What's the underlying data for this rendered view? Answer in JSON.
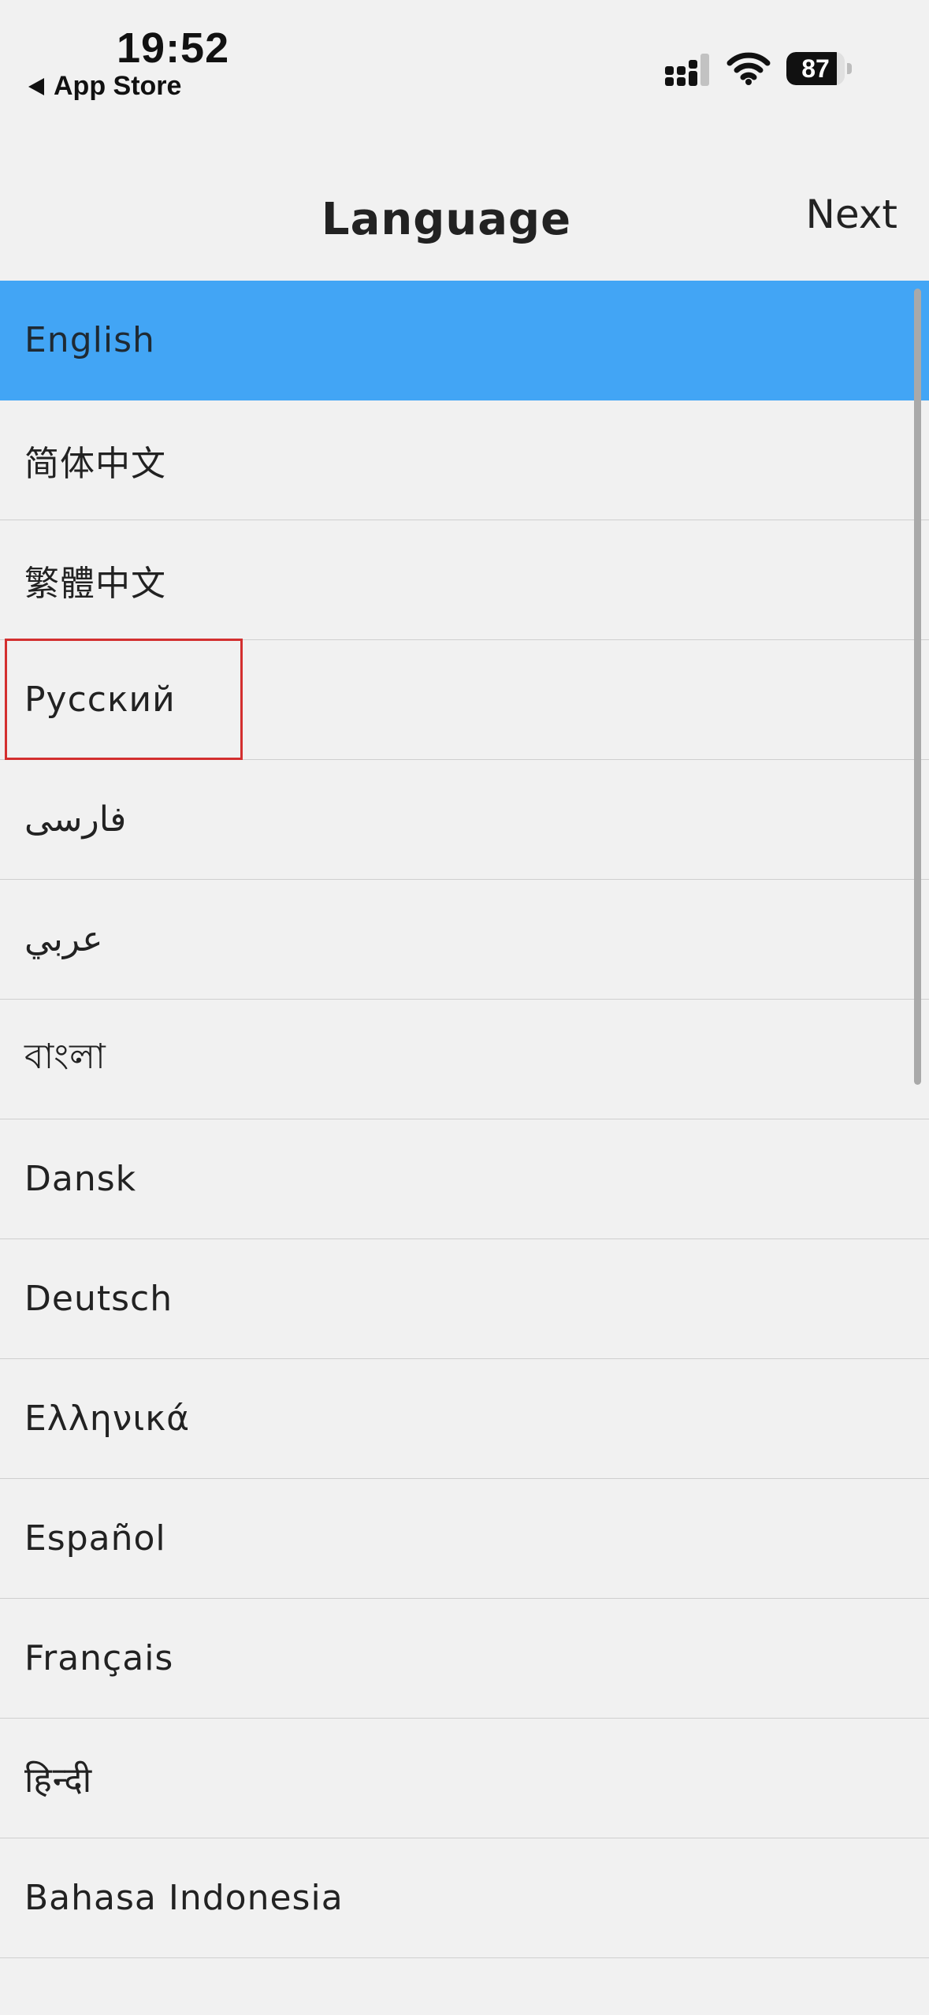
{
  "status_bar": {
    "time": "19:52",
    "back_app": "App Store",
    "battery": "87",
    "battery_level": 0.87
  },
  "header": {
    "title": "Language",
    "next_label": "Next"
  },
  "languages": [
    {
      "label": "English",
      "selected": true
    },
    {
      "label": "简体中文"
    },
    {
      "label": "繁體中文"
    },
    {
      "label": "Русский",
      "highlighted": true
    },
    {
      "label": "فارسی"
    },
    {
      "label": "عربي"
    },
    {
      "label": "বাংলা"
    },
    {
      "label": "Dansk"
    },
    {
      "label": "Deutsch"
    },
    {
      "label": "Ελληνικά"
    },
    {
      "label": "Español"
    },
    {
      "label": "Français"
    },
    {
      "label": "हिन्दी"
    },
    {
      "label": "Bahasa Indonesia"
    }
  ],
  "colors": {
    "selected_bg": "#42a5f5",
    "highlight_border": "#d32f2f",
    "background": "#f1f1f1"
  },
  "icons": {
    "back": "back-triangle-icon",
    "signal": "cellular-signal-icon",
    "wifi": "wifi-icon",
    "battery": "battery-icon"
  }
}
